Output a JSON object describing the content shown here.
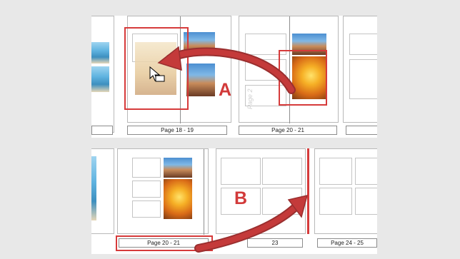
{
  "top_panel": {
    "pages": [
      "Page 18 - 19",
      "Page 20 - 21"
    ],
    "marker": "A"
  },
  "bottom_panel": {
    "pages": [
      "Page 20 - 21",
      "23",
      "Page 24 - 25"
    ],
    "marker": "B"
  },
  "spine_text": "Page 2",
  "colors": {
    "accent": "#d63b3b",
    "background": "#e8e8e8"
  }
}
